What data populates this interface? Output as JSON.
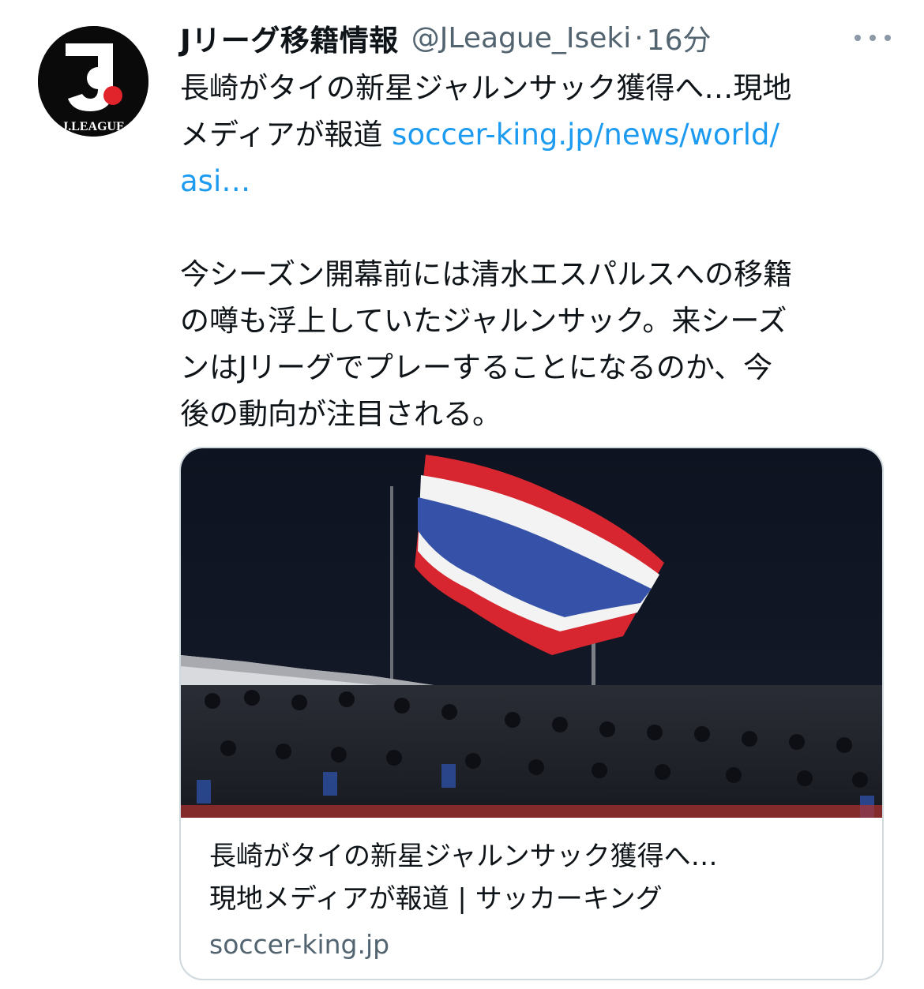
{
  "tweet": {
    "avatar_icon": "jleague-logo-icon",
    "avatar_text": "J.LEAGUE",
    "display_name": "Jリーグ移籍情報",
    "handle": "@JLeague_Iseki",
    "separator": "·",
    "time": "16分",
    "more_icon": "more-dots-icon",
    "text_line1": "長崎がタイの新星ジャルンサック獲得へ…現地",
    "text_line2_prefix": "メディアが報道 ",
    "link_part1": "soccer-king.jp/news/world/",
    "link_part2": "asi…",
    "body_line1": "今シーズン開幕前には清水エスパルスへの移籍",
    "body_line2": "の噂も浮上していたジャルンサック。来シーズ",
    "body_line3": "ンはJリーグでプレーすることになるのか、今",
    "body_line4": "後の動向が注目される。"
  },
  "card": {
    "image_desc_icon": "thai-flag-stadium-photo",
    "title_line1": "長崎がタイの新星ジャルンサック獲得へ…",
    "title_line2": "現地メディアが報道 | サッカーキング",
    "domain": "soccer-king.jp"
  },
  "colors": {
    "link": "#1d9bf0",
    "secondary_text": "#536471",
    "border": "#cfd9de",
    "flag_red": "#d7262f",
    "flag_blue": "#3552a8"
  }
}
